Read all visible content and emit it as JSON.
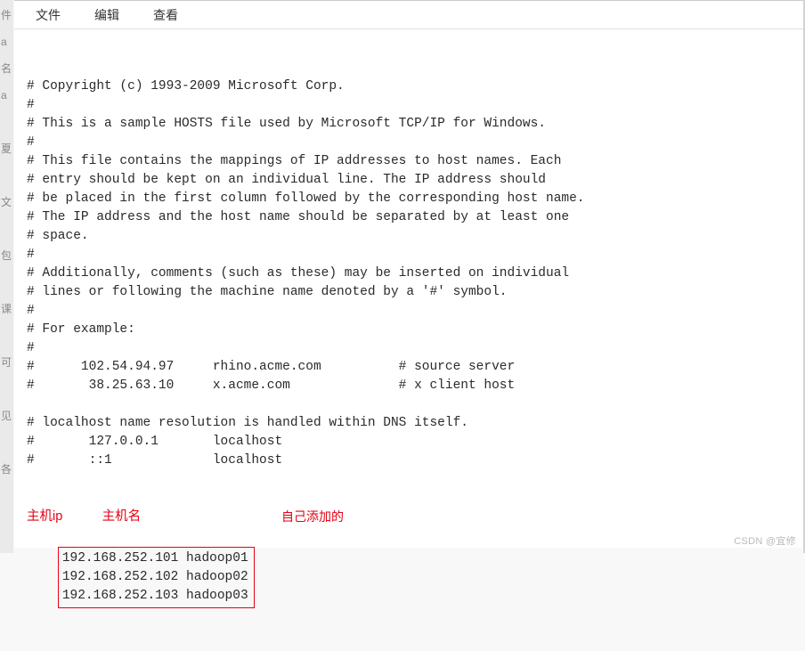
{
  "left_fragments": [
    "件",
    "a",
    "名",
    "a",
    "",
    "夏",
    "",
    "文",
    "",
    "包",
    "",
    "课",
    "",
    "可",
    "",
    "见",
    "",
    "各"
  ],
  "menubar": {
    "file": "文件",
    "edit": "编辑",
    "view": "查看"
  },
  "hosts_lines": [
    "# Copyright (c) 1993-2009 Microsoft Corp.",
    "#",
    "# This is a sample HOSTS file used by Microsoft TCP/IP for Windows.",
    "#",
    "# This file contains the mappings of IP addresses to host names. Each",
    "# entry should be kept on an individual line. The IP address should",
    "# be placed in the first column followed by the corresponding host name.",
    "# The IP address and the host name should be separated by at least one",
    "# space.",
    "#",
    "# Additionally, comments (such as these) may be inserted on individual",
    "# lines or following the machine name denoted by a '#' symbol.",
    "#",
    "# For example:",
    "#",
    "#      102.54.94.97     rhino.acme.com          # source server",
    "#       38.25.63.10     x.acme.com              # x client host",
    "",
    "# localhost name resolution is handled within DNS itself.",
    "#       127.0.0.1       localhost",
    "#       ::1             localhost"
  ],
  "labels": {
    "host_ip": "主机ip",
    "host_name": "主机名",
    "self_added": "自己添加的"
  },
  "added_entries": [
    {
      "ip": "192.168.252.101",
      "name": "hadoop01"
    },
    {
      "ip": "192.168.252.102",
      "name": "hadoop02"
    },
    {
      "ip": "192.168.252.103",
      "name": "hadoop03"
    }
  ],
  "watermark": "CSDN @宜修"
}
